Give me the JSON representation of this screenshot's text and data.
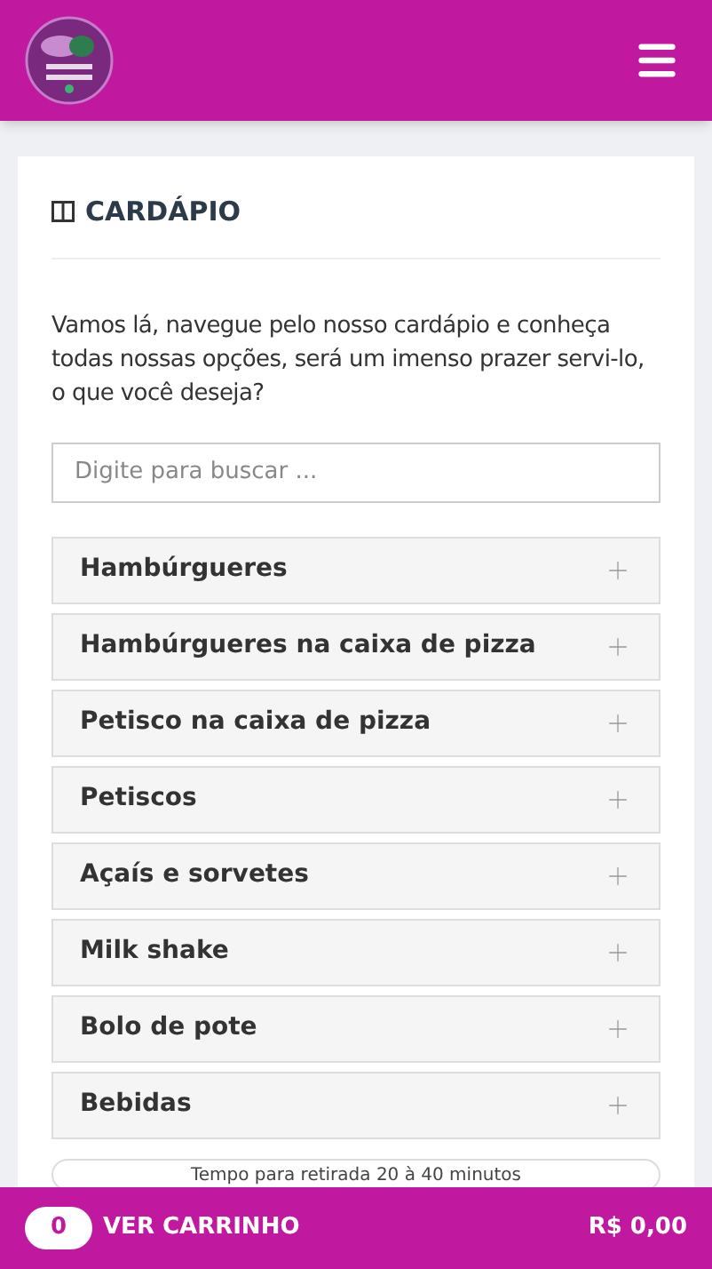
{
  "card": {
    "title": "CARDÁPIO",
    "intro": "Vamos lá, navegue pelo nosso cardápio e conheça todas nossas opções, será um imenso prazer servi-lo, o que você deseja?",
    "search": {
      "placeholder": "Digite para buscar ..."
    },
    "categories": [
      {
        "label": "Hambúrgueres",
        "expanded": false
      },
      {
        "label": "Hambúrgueres na caixa de pizza",
        "expanded": false
      },
      {
        "label": "Petisco na caixa de pizza",
        "expanded": false
      },
      {
        "label": "Petiscos",
        "expanded": false
      },
      {
        "label": "Açaís e sorvetes",
        "expanded": false
      },
      {
        "label": "Milk shake",
        "expanded": false
      },
      {
        "label": "Bolo de pote",
        "expanded": false
      },
      {
        "label": "Bebidas",
        "expanded": false
      }
    ],
    "notice": "Tempo para retirada 20 à 40 minutos"
  },
  "cart_bar": {
    "count": "0",
    "label": "VER CARRINHO",
    "total": "R$ 0,00"
  }
}
